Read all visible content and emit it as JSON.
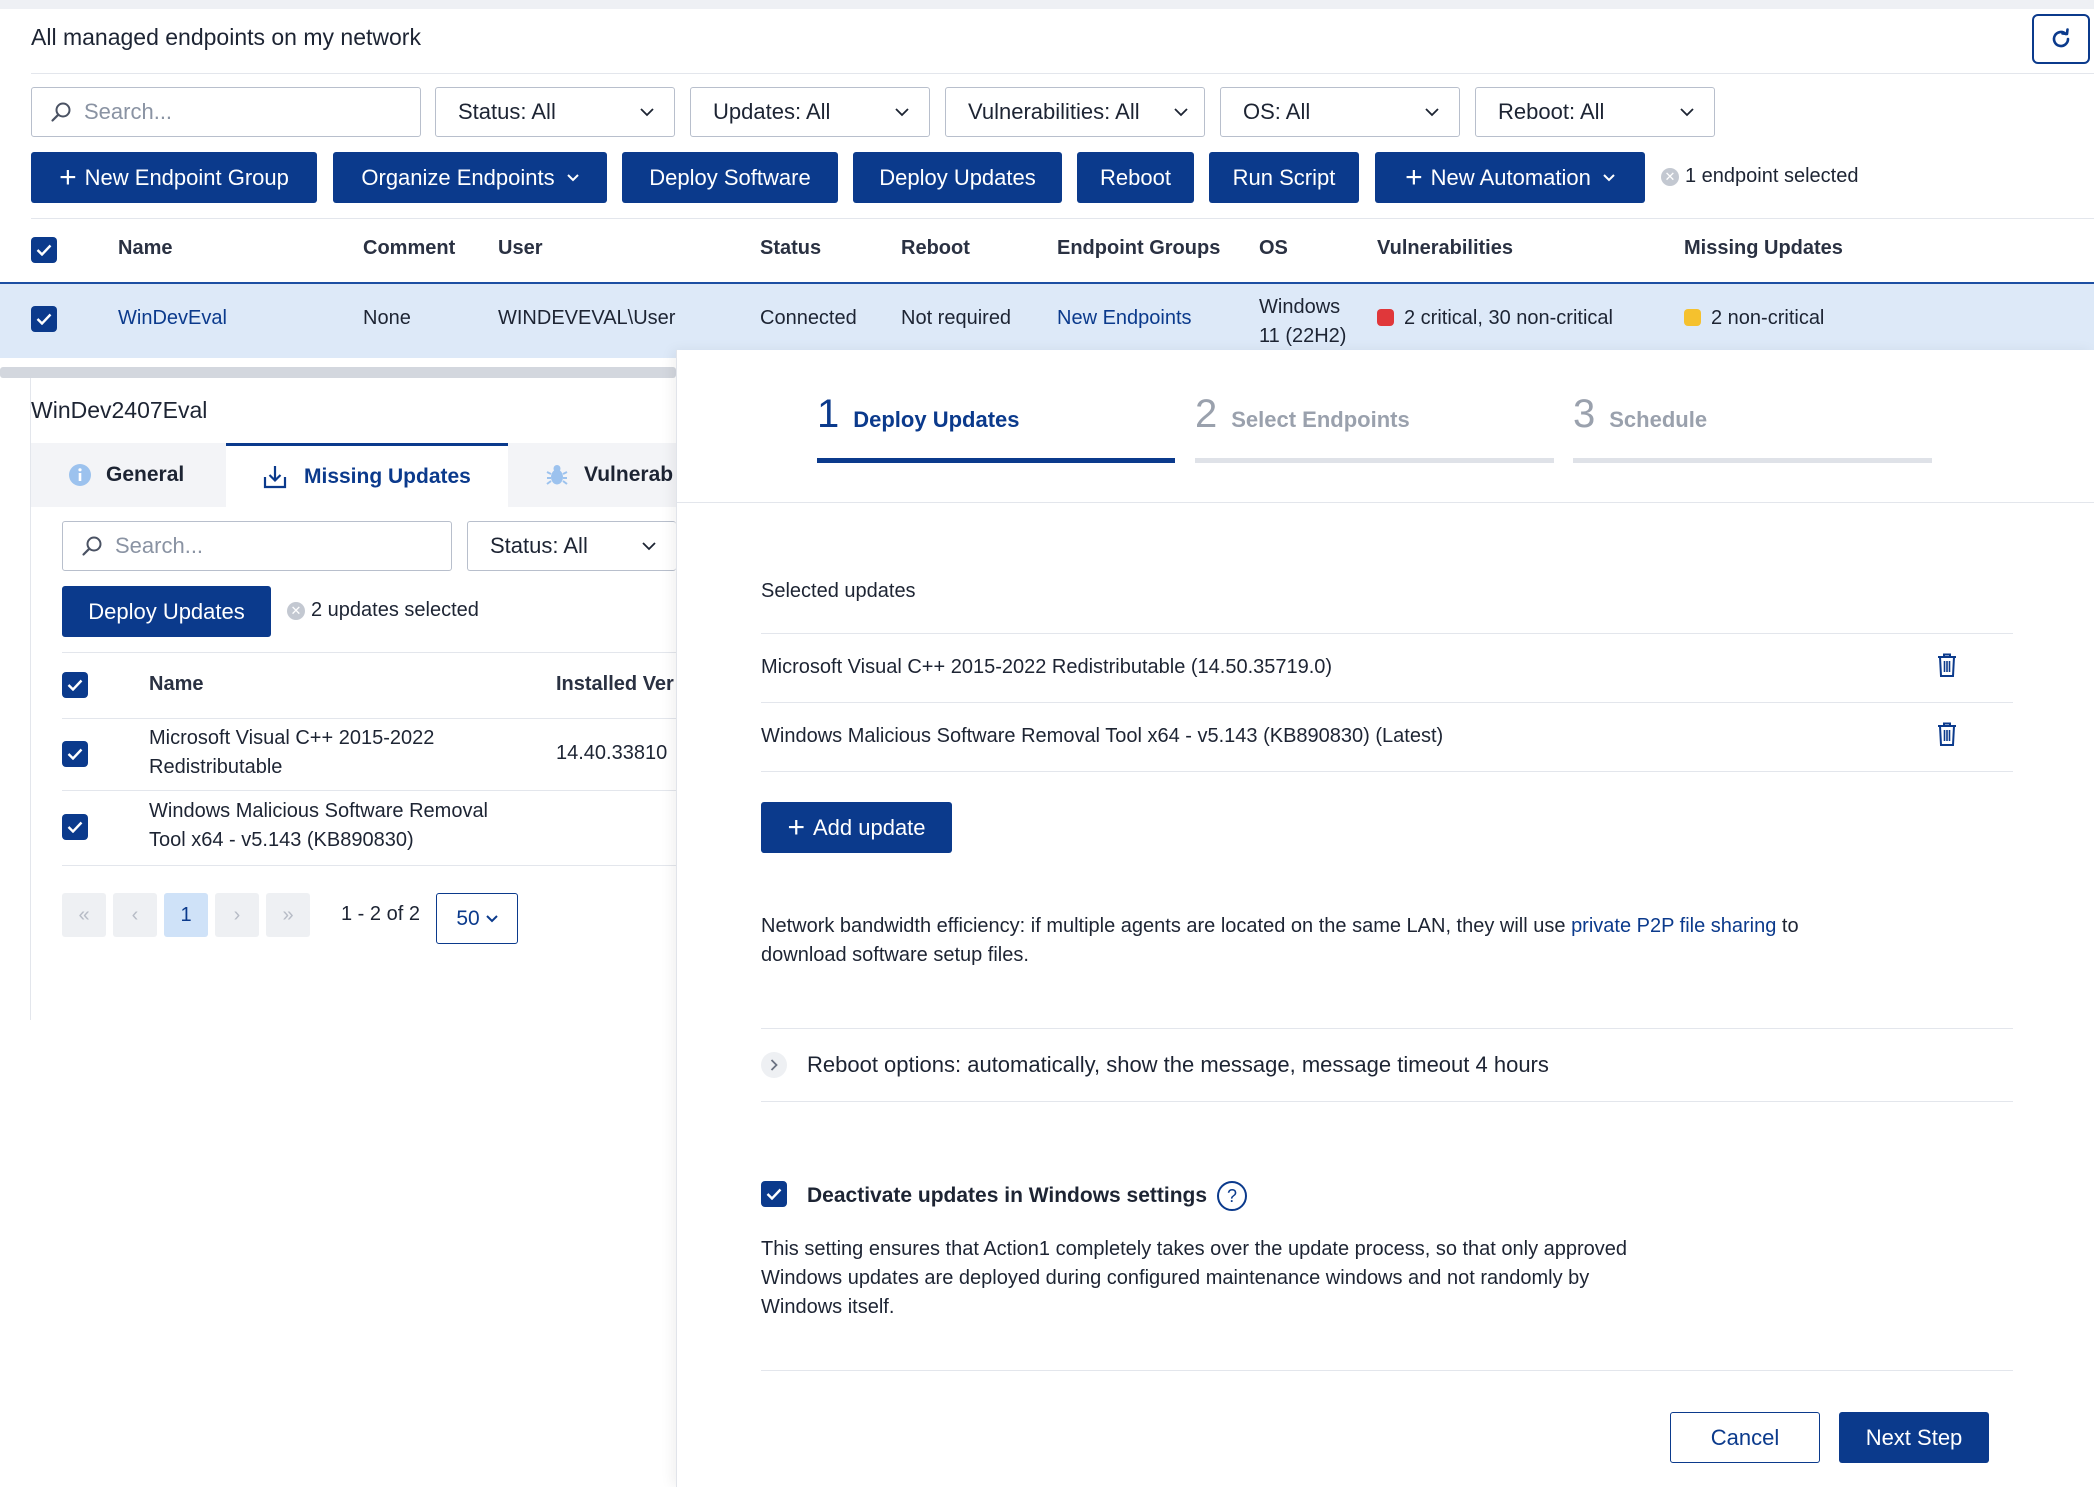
{
  "header": {
    "title": "All managed endpoints on my network"
  },
  "filters": {
    "search_placeholder": "Search...",
    "status": "Status: All",
    "updates": "Updates: All",
    "vulnerabilities": "Vulnerabilities: All",
    "os": "OS: All",
    "reboot": "Reboot: All"
  },
  "toolbar": {
    "new_endpoint_group": "New Endpoint Group",
    "organize_endpoints": "Organize Endpoints",
    "deploy_software": "Deploy Software",
    "deploy_updates": "Deploy Updates",
    "reboot": "Reboot",
    "run_script": "Run Script",
    "new_automation": "New Automation",
    "selected_count": "1 endpoint selected"
  },
  "table": {
    "columns": [
      "Name",
      "Comment",
      "User",
      "Status",
      "Reboot",
      "Endpoint Groups",
      "OS",
      "Vulnerabilities",
      "Missing Updates"
    ],
    "row": {
      "name": "WinDevEval",
      "comment": "None",
      "user": "WINDEVEVAL\\User",
      "status": "Connected",
      "reboot": "Not required",
      "group": "New Endpoints",
      "os_line1": "Windows",
      "os_line2": "11 (22H2)",
      "vulnerabilities": "2 critical,  30 non-critical",
      "missing_updates": "2 non-critical"
    }
  },
  "detail": {
    "title": "WinDev2407Eval",
    "tabs": [
      "General",
      "Missing Updates",
      "Vulnerab"
    ],
    "search_placeholder": "Search...",
    "status_filter": "Status: All",
    "deploy_button": "Deploy Updates",
    "selected_count": "2 updates selected",
    "columns": [
      "Name",
      "Installed Ver"
    ],
    "rows": [
      {
        "name_line1": "Microsoft Visual C++ 2015-2022",
        "name_line2": "Redistributable",
        "installed": "14.40.33810"
      },
      {
        "name_line1": "Windows Malicious Software Removal",
        "name_line2": "Tool x64 - v5.143 (KB890830)",
        "installed": ""
      }
    ],
    "pager": {
      "first": "«",
      "prev": "‹",
      "current": "1",
      "next": "›",
      "last": "»",
      "range": "1 - 2 of 2",
      "page_size": "50"
    }
  },
  "wizard": {
    "steps": [
      {
        "num": "1",
        "label": "Deploy Updates"
      },
      {
        "num": "2",
        "label": "Select Endpoints"
      },
      {
        "num": "3",
        "label": "Schedule"
      }
    ],
    "selected_updates_label": "Selected updates",
    "updates": [
      "Microsoft Visual C++ 2015-2022 Redistributable (14.50.35719.0)",
      "Windows Malicious Software Removal Tool x64 - v5.143 (KB890830) (Latest)"
    ],
    "add_update": "Add update",
    "bandwidth_text_before": "Network bandwidth efficiency: if multiple agents are located on the same LAN, they will use ",
    "bandwidth_link": "private P2P file sharing",
    "bandwidth_text_after": " to",
    "bandwidth_line2": "download software setup files.",
    "reboot_options": "Reboot options: automatically, show the message, message timeout 4 hours",
    "deactivate_label": "Deactivate updates in Windows settings",
    "deactivate_desc_line1": "This setting ensures that Action1 completely takes over the update process, so that only approved",
    "deactivate_desc_line2": "Windows updates are deployed during configured maintenance windows and not randomly by",
    "deactivate_desc_line3": "Windows itself.",
    "cancel": "Cancel",
    "next_step": "Next Step"
  },
  "colors": {
    "primary": "#0b3a8c",
    "critical": "#e0373a",
    "warning": "#f5c12e",
    "selected_row": "#dde9f8"
  }
}
